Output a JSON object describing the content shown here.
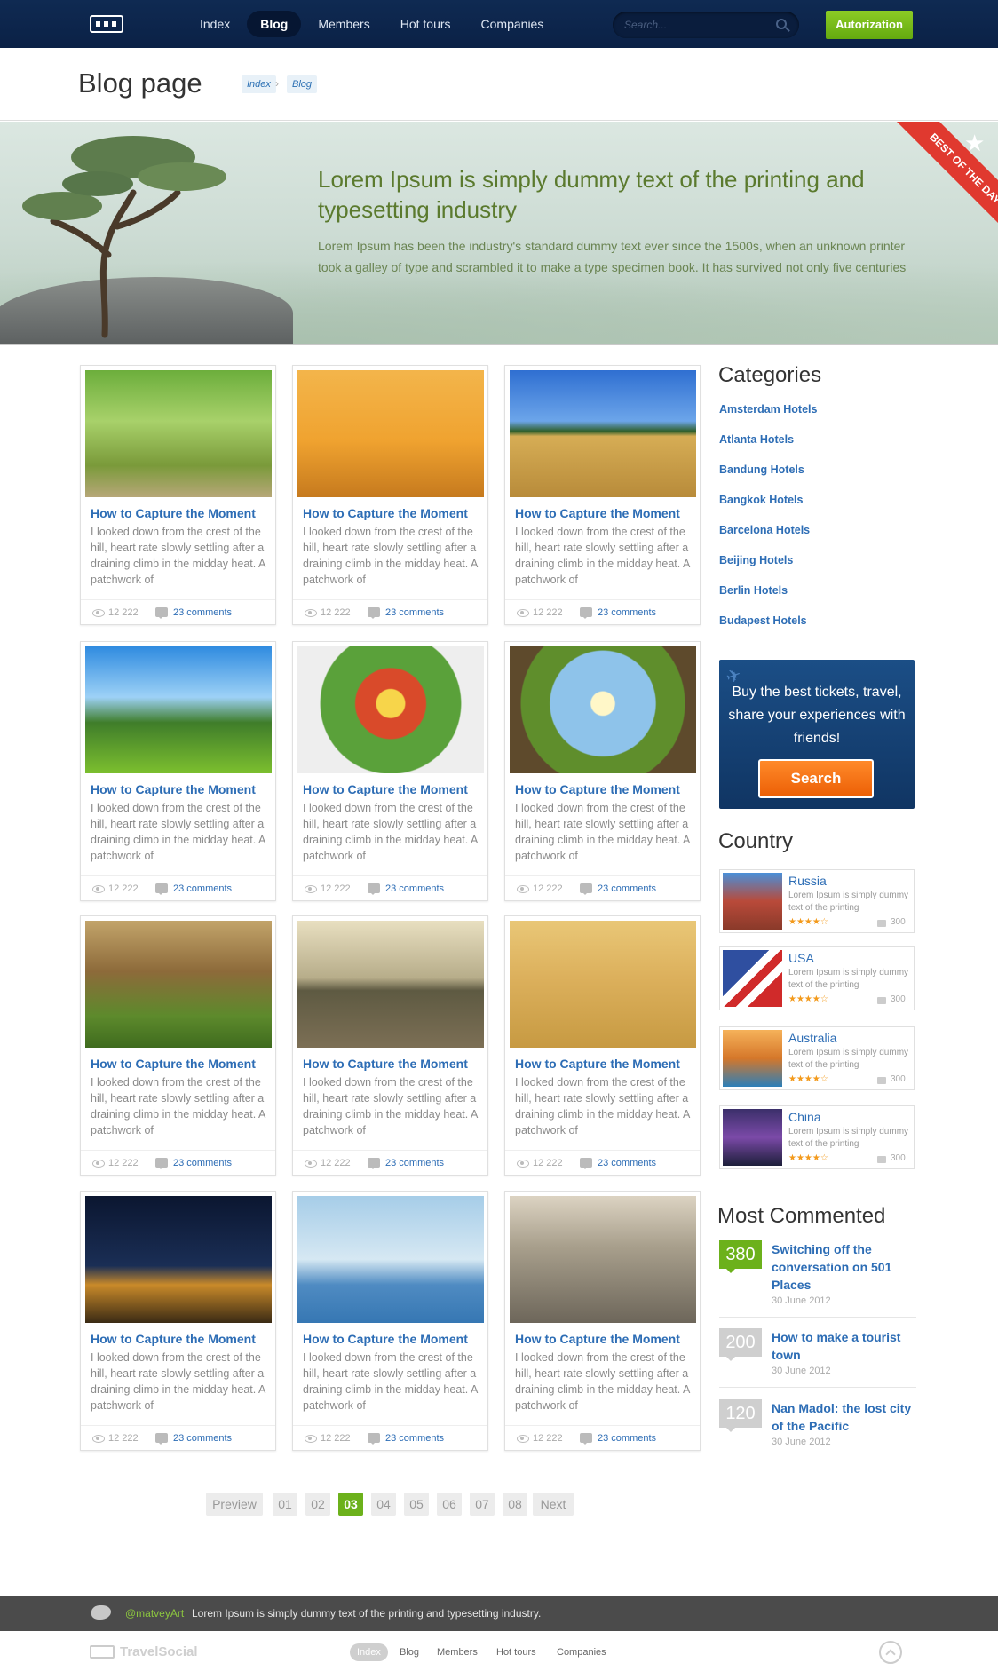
{
  "header": {
    "nav": [
      "Index",
      "Blog",
      "Members",
      "Hot tours",
      "Companies"
    ],
    "active_nav": "Blog",
    "search_placeholder": "Search...",
    "auth_label": "Autorization"
  },
  "titlebar": {
    "title": "Blog page",
    "breadcrumb": [
      "Index",
      "Blog"
    ]
  },
  "hero": {
    "title": "Lorem Ipsum is simply dummy text of the printing and typesetting industry",
    "text": "Lorem Ipsum has been the industry's standard dummy text ever since the 1500s, when an unknown printer took a galley of type and scrambled it to make a type specimen book. It has survived not only five centuries",
    "ribbon": "BEST OF THE DAY"
  },
  "posts": [
    {
      "title": "How to Capture the Moment",
      "text": "I looked down from the crest of the hill, heart rate slowly settling after a draining climb in the midday heat. A patchwork of",
      "views": "12 222",
      "comments": "23 comments"
    },
    {
      "title": "How to Capture the Moment",
      "text": "I looked down from the crest of the hill, heart rate slowly settling after a draining climb in the midday heat. A patchwork of",
      "views": "12 222",
      "comments": "23 comments"
    },
    {
      "title": "How to Capture the Moment",
      "text": "I looked down from the crest of the hill, heart rate slowly settling after a draining climb in the midday heat. A patchwork of",
      "views": "12 222",
      "comments": "23 comments"
    },
    {
      "title": "How to Capture the Moment",
      "text": "I looked down from the crest of the hill, heart rate slowly settling after a draining climb in the midday heat. A patchwork of",
      "views": "12 222",
      "comments": "23 comments"
    },
    {
      "title": "How to Capture the Moment",
      "text": "I looked down from the crest of the hill, heart rate slowly settling after a draining climb in the midday heat. A patchwork of",
      "views": "12 222",
      "comments": "23 comments"
    },
    {
      "title": "How to Capture the Moment",
      "text": "I looked down from the crest of the hill, heart rate slowly settling after a draining climb in the midday heat. A patchwork of",
      "views": "12 222",
      "comments": "23 comments"
    },
    {
      "title": "How to Capture the Moment",
      "text": "I looked down from the crest of the hill, heart rate slowly settling after a draining climb in the midday heat. A patchwork of",
      "views": "12 222",
      "comments": "23 comments"
    },
    {
      "title": "How to Capture the Moment",
      "text": "I looked down from the crest of the hill, heart rate slowly settling after a draining climb in the midday heat. A patchwork of",
      "views": "12 222",
      "comments": "23 comments"
    },
    {
      "title": "How to Capture the Moment",
      "text": "I looked down from the crest of the hill, heart rate slowly settling after a draining climb in the midday heat. A patchwork of",
      "views": "12 222",
      "comments": "23 comments"
    },
    {
      "title": "How to Capture the Moment",
      "text": "I looked down from the crest of the hill, heart rate slowly settling after a draining climb in the midday heat. A patchwork of",
      "views": "12 222",
      "comments": "23 comments"
    },
    {
      "title": "How to Capture the Moment",
      "text": "I looked down from the crest of the hill, heart rate slowly settling after a draining climb in the midday heat. A patchwork of",
      "views": "12 222",
      "comments": "23 comments"
    },
    {
      "title": "How to Capture the Moment",
      "text": "I looked down from the crest of the hill, heart rate slowly settling after a draining climb in the midday heat. A patchwork of",
      "views": "12 222",
      "comments": "23 comments"
    }
  ],
  "sidebar": {
    "categories_title": "Categories",
    "categories": [
      "Amsterdam Hotels",
      "Atlanta Hotels",
      "Bandung Hotels",
      "Bangkok Hotels",
      "Barcelona Hotels",
      "Beijing Hotels",
      "Berlin Hotels",
      "Budapest Hotels"
    ],
    "promo_text": "Buy the best tickets, travel, share your experiences with friends!",
    "promo_button": "Search",
    "country_title": "Country",
    "countries": [
      {
        "name": "Russia",
        "desc": "Lorem Ipsum is simply dummy text of the printing",
        "rating": 4,
        "count": "300"
      },
      {
        "name": "USA",
        "desc": "Lorem Ipsum is simply dummy text of the printing",
        "rating": 4,
        "count": "300"
      },
      {
        "name": "Australia",
        "desc": "Lorem Ipsum is simply dummy text of the printing",
        "rating": 4,
        "count": "300"
      },
      {
        "name": "China",
        "desc": "Lorem Ipsum is simply dummy text of the printing",
        "rating": 4,
        "count": "300"
      }
    ],
    "most_commented_title": "Most Commented",
    "most_commented": [
      {
        "count": "380",
        "title": "Switching off the conversation on 501 Places",
        "date": "30 June 2012",
        "color": "#6cb11b"
      },
      {
        "count": "200",
        "title": "How to make a tourist town",
        "date": "30 June 2012",
        "color": "#cfcfcf"
      },
      {
        "count": "120",
        "title": "Nan Madol: the lost city of the Pacific",
        "date": "30 June 2012",
        "color": "#cfcfcf"
      }
    ]
  },
  "pagination": {
    "prev": "Preview",
    "pages": [
      "01",
      "02",
      "03",
      "04",
      "05",
      "06",
      "07",
      "08"
    ],
    "active": "03",
    "next": "Next"
  },
  "footer": {
    "tweet_handle": "@matveyArt",
    "tweet_text": "Lorem Ipsum is simply dummy text of the printing and typesetting industry.",
    "brand": "TravelSocial",
    "nav": [
      "Index",
      "Blog",
      "Members",
      "Hot tours",
      "Companies"
    ],
    "active_nav": "Index"
  },
  "colors": {
    "accent": "#2d6db5",
    "green": "#6cb11b",
    "header": "#0f2a52",
    "ribbon": "#e0392f",
    "button": "#ec5f05"
  }
}
